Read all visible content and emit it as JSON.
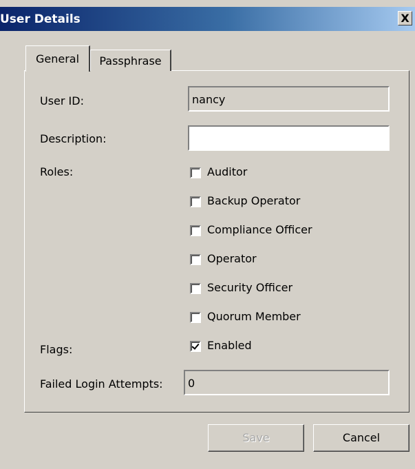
{
  "window": {
    "title": "User Details",
    "close_glyph": "X"
  },
  "tabs": [
    {
      "label": "General",
      "selected": true
    },
    {
      "label": "Passphrase",
      "selected": false
    }
  ],
  "form": {
    "user_id_label": "User ID:",
    "user_id_value": "nancy",
    "description_label": "Description:",
    "description_value": "",
    "roles_label": "Roles:",
    "roles": [
      {
        "label": "Auditor",
        "checked": false
      },
      {
        "label": "Backup Operator",
        "checked": false
      },
      {
        "label": "Compliance Officer",
        "checked": false
      },
      {
        "label": "Operator",
        "checked": false
      },
      {
        "label": "Security Officer",
        "checked": false
      },
      {
        "label": "Quorum Member",
        "checked": false
      }
    ],
    "flags_label": "Flags:",
    "flags": [
      {
        "label": "Enabled",
        "checked": true
      }
    ],
    "failed_login_label": "Failed Login Attempts:",
    "failed_login_value": "0"
  },
  "buttons": {
    "save_label": "Save",
    "save_enabled": false,
    "cancel_label": "Cancel"
  }
}
